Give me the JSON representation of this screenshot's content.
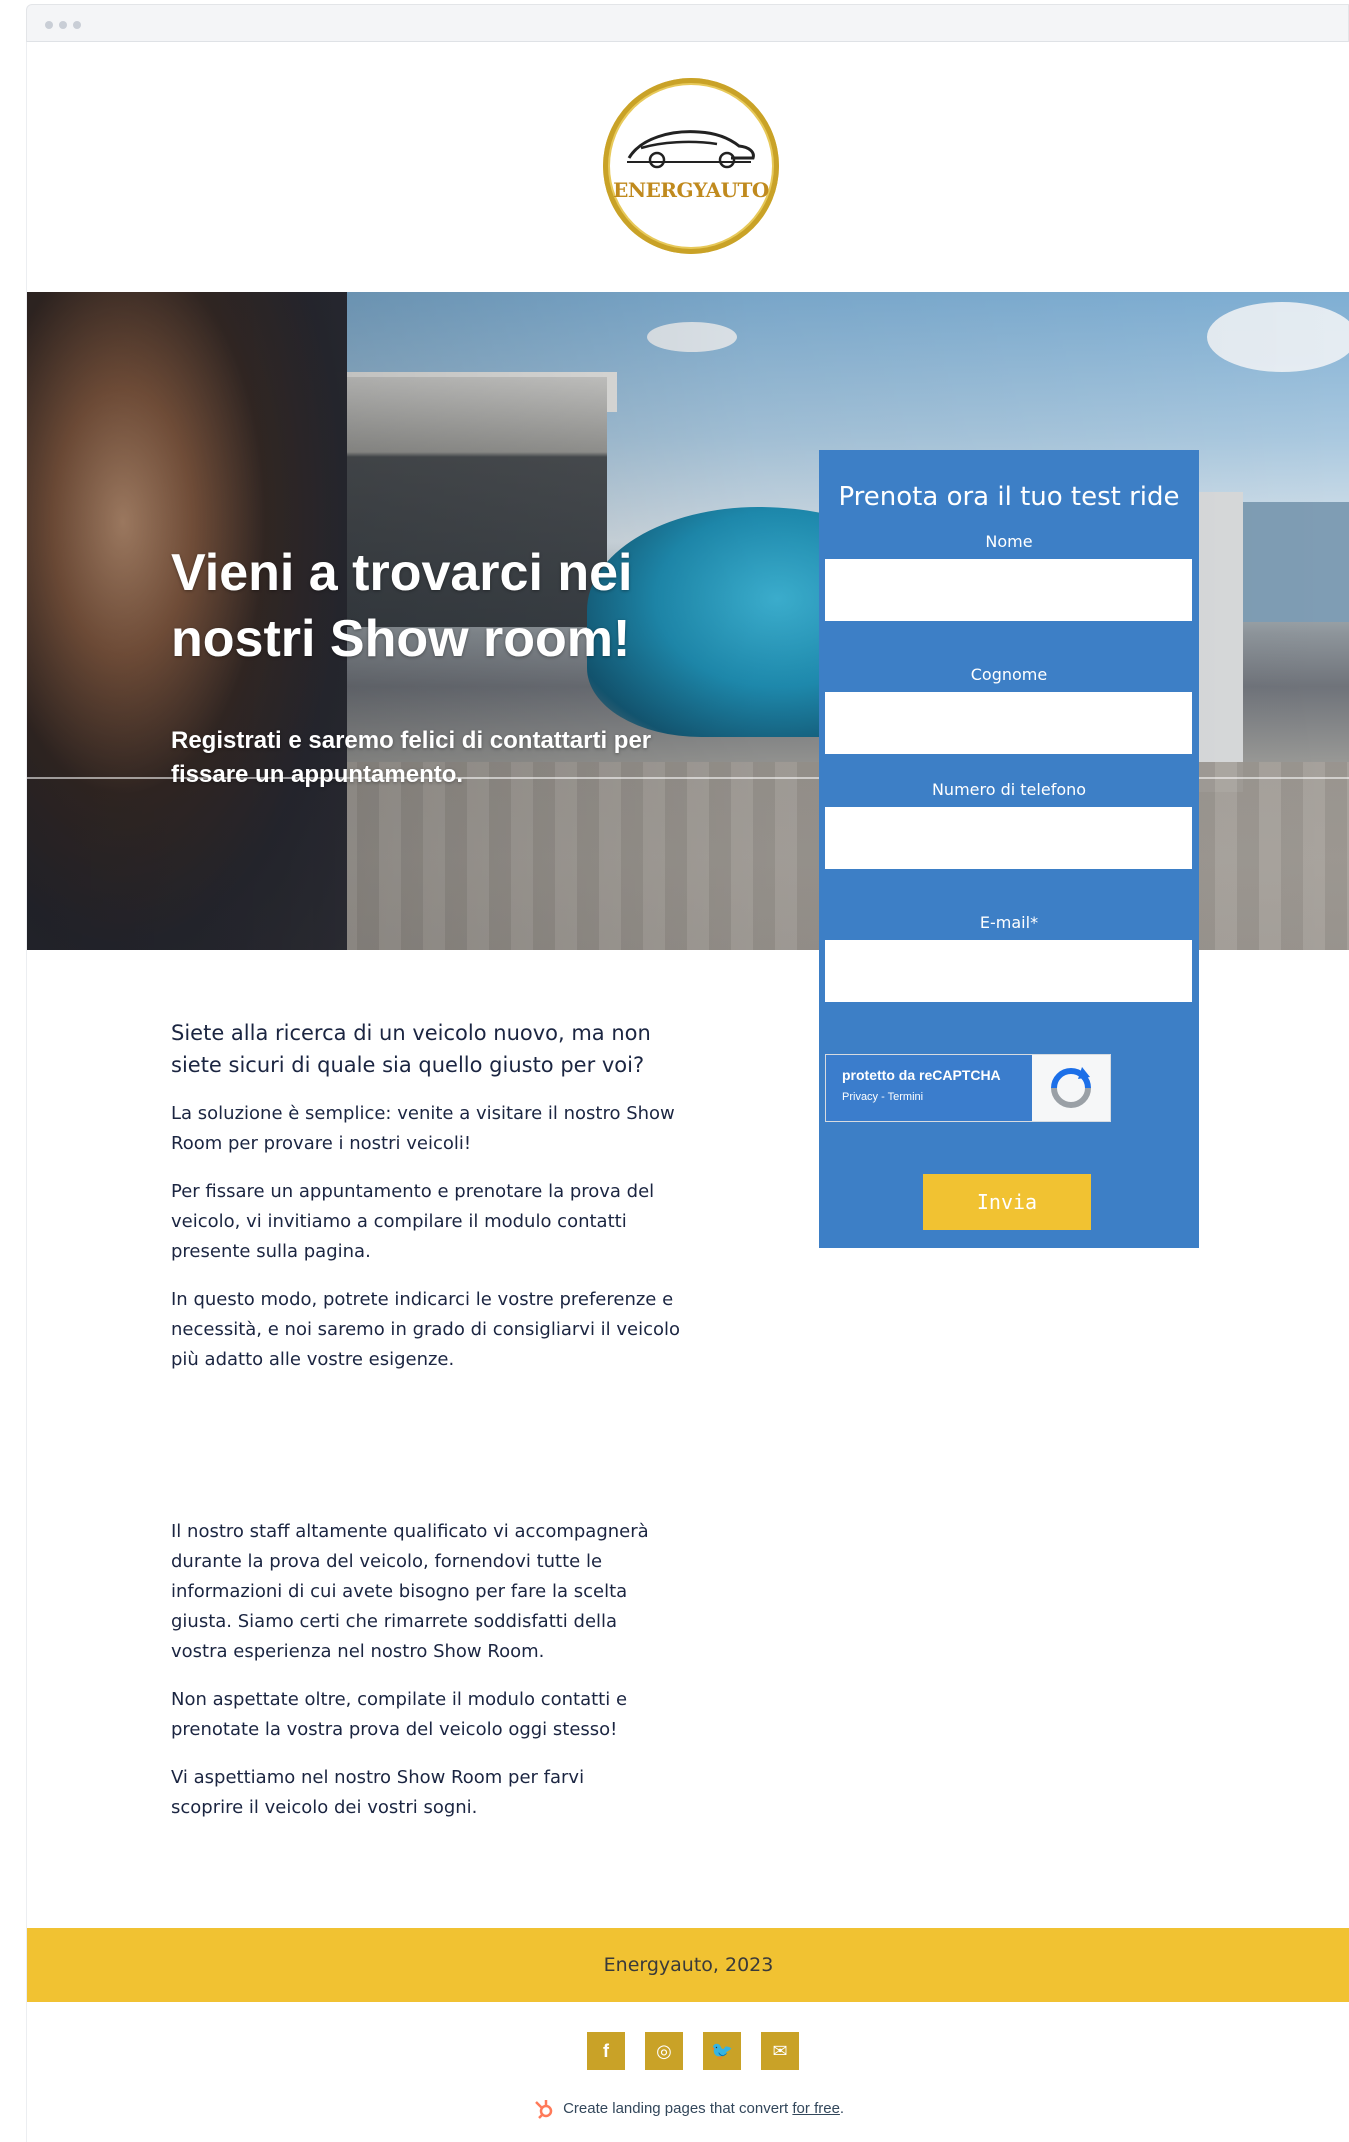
{
  "brand": {
    "logo_text": "ENERGYAUTO"
  },
  "hero": {
    "title": "Vieni a trovarci nei nostri Show room!",
    "subtitle": "Registrati e saremo felici di contattarti per fissare un appuntamento."
  },
  "form": {
    "title": "Prenota ora il tuo test ride",
    "fields": [
      {
        "label": "Nome",
        "value": ""
      },
      {
        "label": "Cognome",
        "value": ""
      },
      {
        "label": "Numero di telefono",
        "value": ""
      },
      {
        "label": "E-mail*",
        "value": ""
      }
    ],
    "recaptcha": {
      "main": "protetto da reCAPTCHA",
      "links": "Privacy - Termini"
    },
    "submit_label": "Invia"
  },
  "content": {
    "lead": "Siete alla ricerca di un veicolo nuovo, ma non siete sicuri di quale sia quello giusto per voi?",
    "paragraphs": [
      "La soluzione è semplice: venite a visitare il nostro Show Room per provare i nostri veicoli!",
      "Per fissare un appuntamento e prenotare la prova del veicolo, vi invitiamo a compilare il modulo contatti presente sulla pagina.",
      "In questo modo, potrete indicarci le vostre preferenze e necessità, e noi saremo in grado di consigliarvi il veicolo più adatto alle vostre esigenze."
    ],
    "paragraphs2": [
      "Il nostro staff altamente qualificato vi accompagnerà durante la prova del veicolo, fornendovi tutte le informazioni di cui avete bisogno per fare la scelta giusta. Siamo certi che rimarrete soddisfatti della vostra esperienza nel nostro Show Room.",
      "Non aspettate oltre, compilate il modulo contatti e prenotate la vostra prova del veicolo oggi stesso!",
      "Vi aspettiamo nel nostro Show Room per farvi scoprire il veicolo dei vostri sogni."
    ]
  },
  "footer": {
    "text": "Energyauto, 2023",
    "social": [
      {
        "icon": "facebook-icon",
        "glyph": "f"
      },
      {
        "icon": "instagram-icon",
        "glyph": "◎"
      },
      {
        "icon": "twitter-icon",
        "glyph": "🐦"
      },
      {
        "icon": "email-icon",
        "glyph": "✉"
      }
    ],
    "hubspot_text": "Create landing pages that convert ",
    "hubspot_link": "for free",
    "hubspot_end": "."
  },
  "colors": {
    "form_bg": "#3d7fc6",
    "accent_yellow": "#f1c232",
    "gold": "#c9a227"
  }
}
